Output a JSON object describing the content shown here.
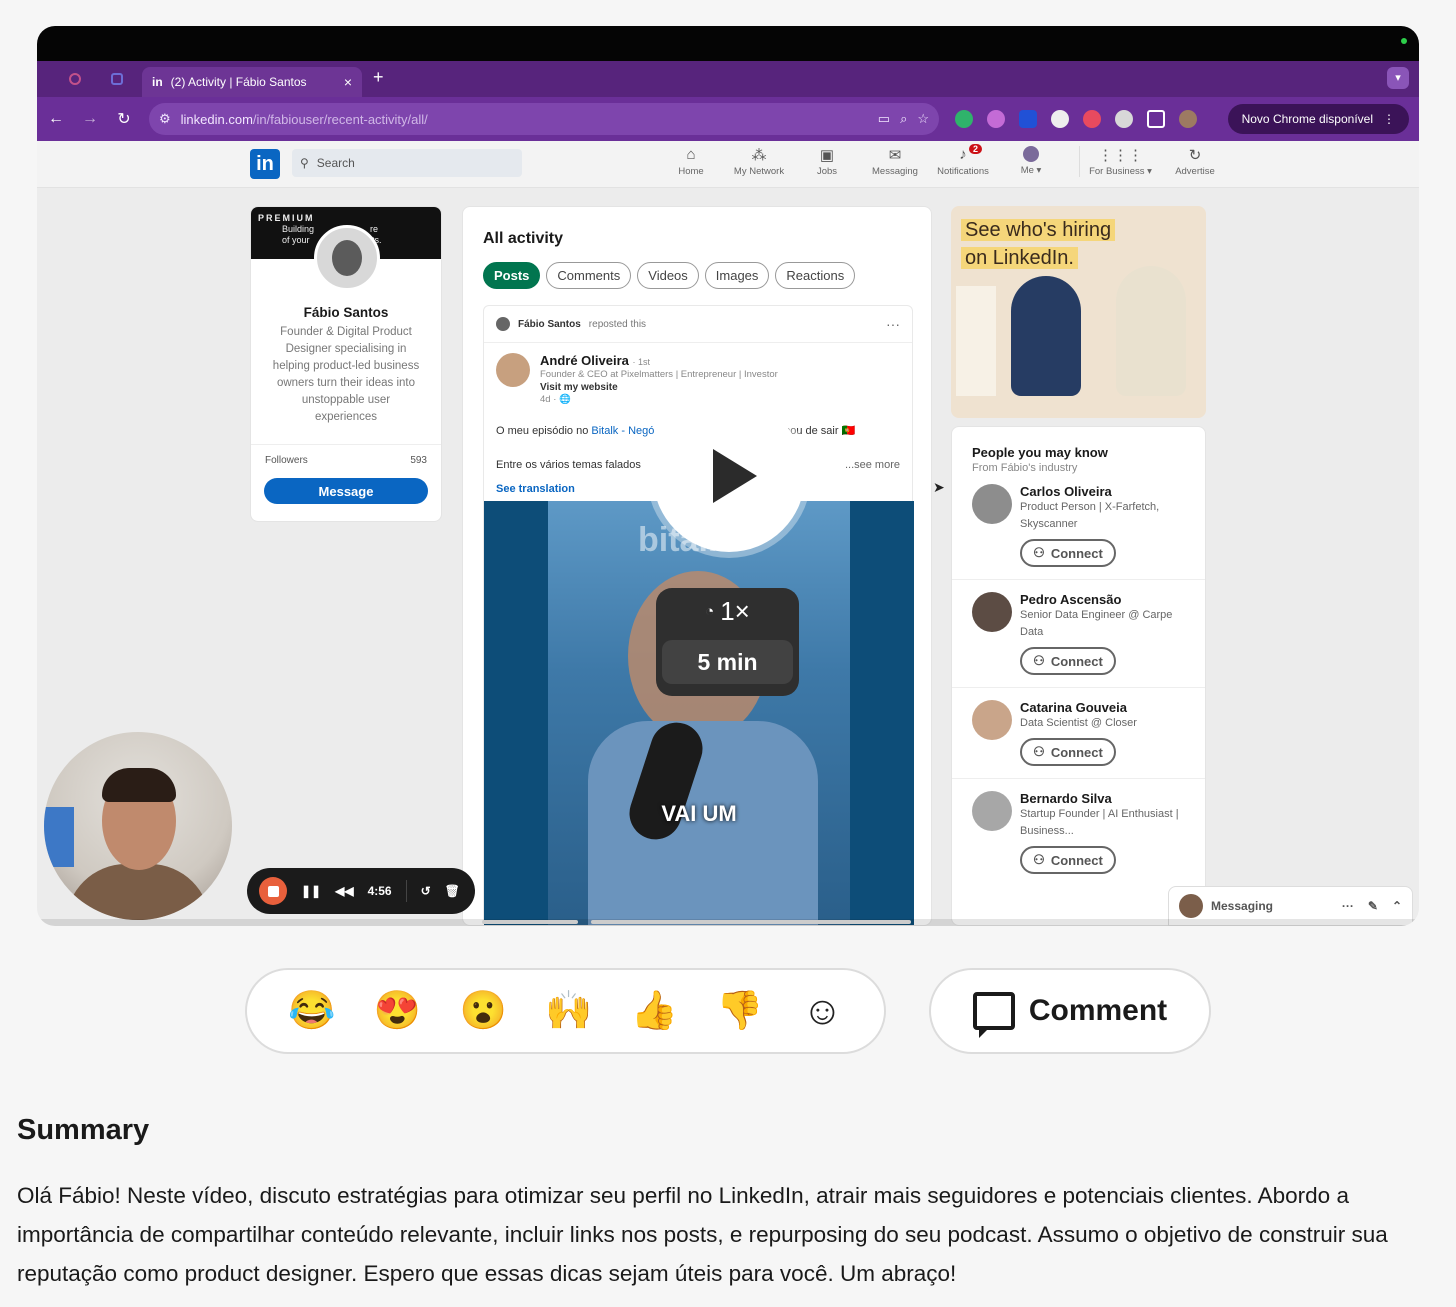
{
  "browser": {
    "tab_title": "(2) Activity | Fábio Santos",
    "tab_icon_text": "in",
    "url_domain": "linkedin.com",
    "url_path": "/in/fabiouser/recent-activity/all/",
    "chrome_update": "Novo Chrome disponível"
  },
  "linkedin": {
    "logo": "in",
    "search_placeholder": "Search",
    "nav": [
      {
        "label": "Home",
        "icon": "home-icon"
      },
      {
        "label": "My Network",
        "icon": "network-icon"
      },
      {
        "label": "Jobs",
        "icon": "jobs-icon"
      },
      {
        "label": "Messaging",
        "icon": "messaging-icon"
      },
      {
        "label": "Notifications",
        "icon": "bell-icon",
        "badge": "2"
      },
      {
        "label": "Me ▾",
        "icon": "avatar-icon"
      },
      {
        "label": "For Business ▾",
        "icon": "grid-icon"
      },
      {
        "label": "Advertise",
        "icon": "advertise-icon"
      }
    ]
  },
  "profile": {
    "banner_tag": "PREMIUM",
    "banner_line1": "Building",
    "banner_line1b": "re",
    "banner_line2": "of your",
    "banner_line2b": "ducts.",
    "name": "Fábio Santos",
    "bio": "Founder & Digital Product Designer specialising in helping product-led business owners turn their ideas into unstoppable user experiences",
    "followers_label": "Followers",
    "followers_count": "593",
    "message_button": "Message"
  },
  "activity": {
    "title": "All activity",
    "filters": [
      "Posts",
      "Comments",
      "Videos",
      "Images",
      "Reactions"
    ],
    "reposter": "Fábio Santos",
    "reposted_text": "reposted this",
    "author_name": "André Oliveira",
    "author_degree": "· 1st",
    "author_headline": "Founder & CEO at Pixelmatters | Entrepreneur | Investor",
    "author_link": "Visit my website",
    "post_age": "4d · 🌐",
    "post_line1_a": "O meu episódio no ",
    "post_line1_link": "Bitalk - Negó",
    "post_line1_b": "acabou de sair 🇵🇹",
    "post_line2": "Entre os vários temas falados",
    "see_more": "...see more",
    "see_translation": "See translation",
    "video_watermark": "bitalk",
    "video_caption": "VAI UM"
  },
  "ad": {
    "line1": "See who's hiring",
    "line2": "on LinkedIn."
  },
  "people": {
    "title": "People you may know",
    "subtitle": "From Fábio's industry",
    "connect_label": "Connect",
    "list": [
      {
        "name": "Carlos Oliveira",
        "role": "Product Person | X-Farfetch, Skyscanner"
      },
      {
        "name": "Pedro Ascensão",
        "role": "Senior Data Engineer @ Carpe Data"
      },
      {
        "name": "Catarina Gouveia",
        "role": "Data Scientist @ Closer"
      },
      {
        "name": "Bernardo Silva",
        "role": "Startup Founder | AI Enthusiast | Business..."
      }
    ]
  },
  "messaging_bar": {
    "label": "Messaging"
  },
  "player": {
    "speed": "1×",
    "duration": "5 min",
    "rec_time": "4:56"
  },
  "reactions": {
    "items": [
      {
        "name": "joy",
        "glyph": "😂"
      },
      {
        "name": "heart-eyes",
        "glyph": "😍"
      },
      {
        "name": "wow",
        "glyph": "😮"
      },
      {
        "name": "raised-hands",
        "glyph": "🙌"
      },
      {
        "name": "thumbs-up",
        "glyph": "👍"
      },
      {
        "name": "thumbs-down",
        "glyph": "👎"
      }
    ],
    "add_glyph": "☺"
  },
  "comment_button": "Comment",
  "summary": {
    "title": "Summary",
    "text": "Olá Fábio! Neste vídeo, discuto estratégias para otimizar seu perfil no LinkedIn, atrair mais seguidores e potenciais clientes. Abordo a importância de compartilhar conteúdo relevante, incluir links nos posts, e repurposing do seu podcast. Assumo o objetivo de construir sua reputação como product designer. Espero que essas dicas sejam úteis para você. Um abraço!"
  },
  "colors": {
    "browser_purple": "#6a2f98",
    "linkedin_blue": "#0a66c2",
    "posts_green": "#01754f",
    "record_orange": "#e8603c"
  }
}
